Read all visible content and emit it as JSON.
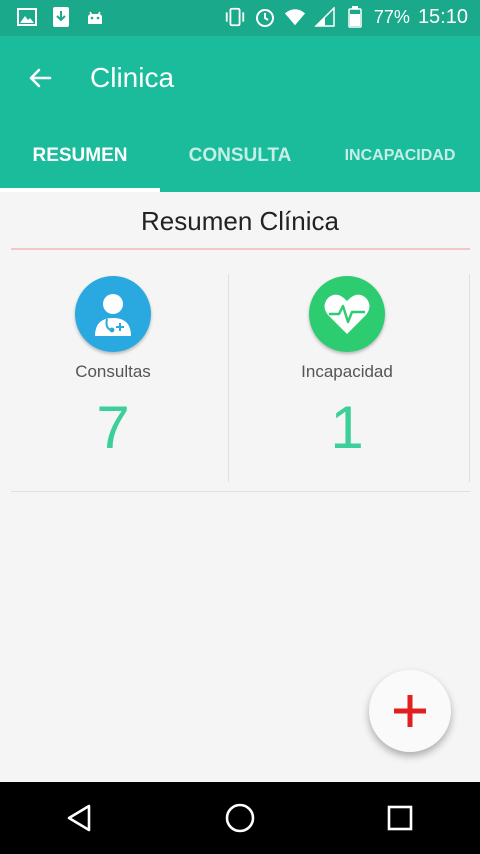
{
  "status_bar": {
    "battery": "77%",
    "time": "15:10"
  },
  "app_bar": {
    "title": "Clinica"
  },
  "tabs": [
    {
      "label": "RESUMEN",
      "active": true
    },
    {
      "label": "CONSULTA",
      "active": false
    },
    {
      "label": "INCAPACIDAD",
      "active": false
    }
  ],
  "summary": {
    "title": "Resumen Clínica",
    "cards": [
      {
        "label": "Consultas",
        "count": "7",
        "icon": "doctor-icon",
        "color": "#29a9e0"
      },
      {
        "label": "Incapacidad",
        "count": "1",
        "icon": "heart-pulse-icon",
        "color": "#2ecc71"
      }
    ]
  },
  "colors": {
    "primary": "#1abc9c",
    "status_bar": "#1aa98a",
    "count": "#3dcf9a",
    "fab_plus": "#e02020"
  }
}
